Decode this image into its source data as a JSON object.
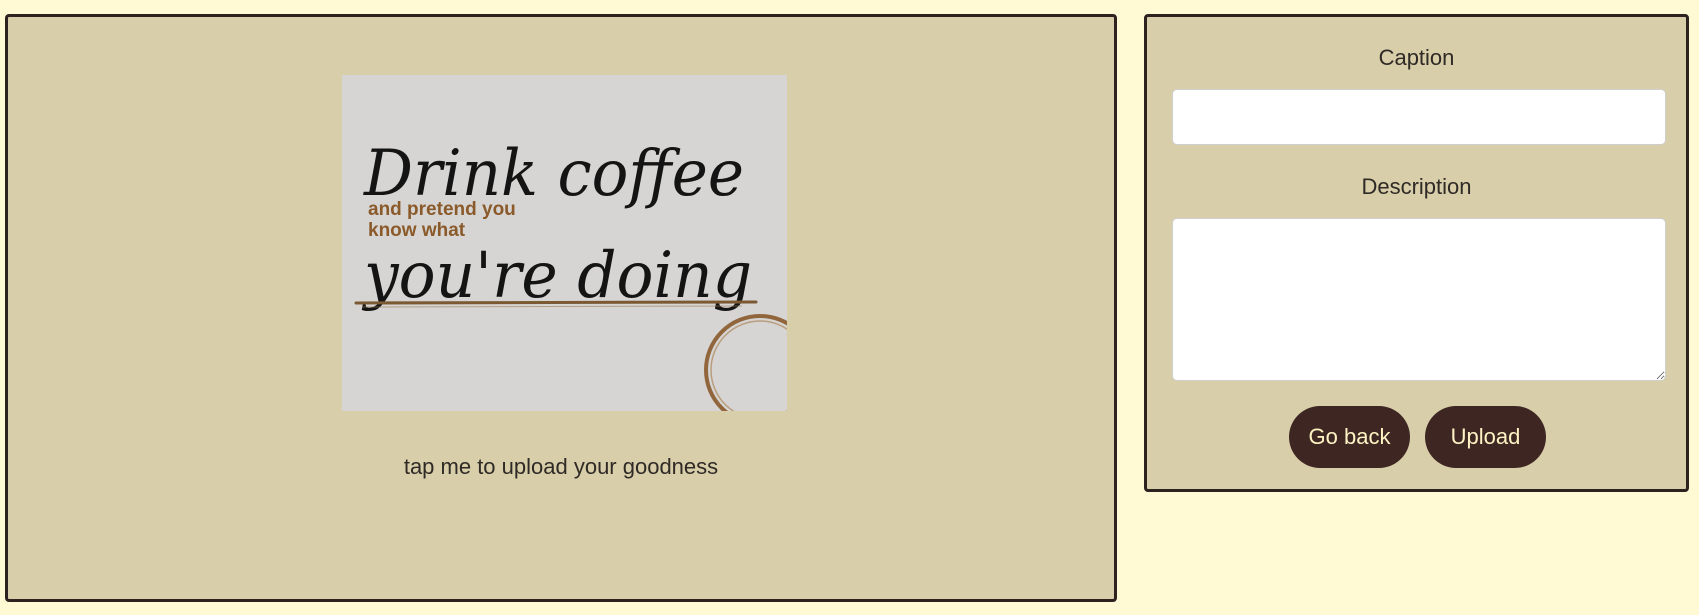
{
  "upload_area": {
    "image_text": {
      "line1": "Drink coffee",
      "line2": "and pretend you",
      "line3": "know what",
      "line4": "you're doing"
    },
    "hint": "tap me to upload your goodness"
  },
  "form": {
    "caption_label": "Caption",
    "caption_value": "",
    "description_label": "Description",
    "description_value": "",
    "go_back_label": "Go back",
    "upload_label": "Upload"
  },
  "colors": {
    "page_bg": "#fff9d4",
    "panel_bg": "#d8cea9",
    "border": "#2e2220",
    "button_bg": "#3e2723",
    "button_text": "#fff3c4",
    "accent_brown": "#8b5a2b"
  }
}
